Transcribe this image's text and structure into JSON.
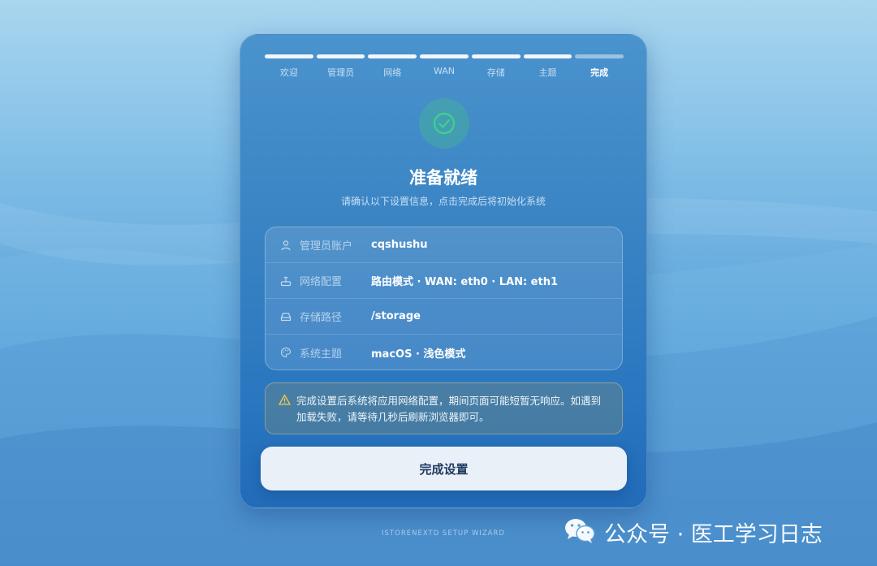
{
  "steps": [
    {
      "label": "欢迎"
    },
    {
      "label": "管理员"
    },
    {
      "label": "网络"
    },
    {
      "label": "WAN"
    },
    {
      "label": "存储"
    },
    {
      "label": "主题"
    },
    {
      "label": "完成"
    }
  ],
  "current_step": "完成",
  "header": {
    "title": "准备就绪",
    "subtitle": "请确认以下设置信息，点击完成后将初始化系统"
  },
  "summary": [
    {
      "icon": "user-icon",
      "label": "管理员账户",
      "value": "cqshushu"
    },
    {
      "icon": "router-icon",
      "label": "网络配置",
      "value": "路由模式 · WAN: eth0 · LAN: eth1"
    },
    {
      "icon": "drive-icon",
      "label": "存储路径",
      "value": "/storage"
    },
    {
      "icon": "palette-icon",
      "label": "系统主题",
      "value": "macOS · 浅色模式"
    }
  ],
  "warning": {
    "icon": "warning-icon",
    "text": "完成设置后系统将应用网络配置，期间页面可能短暂无响应。如遇到加载失败，请等待几秒后刷新浏览器即可。"
  },
  "finish_button": {
    "label": "完成设置"
  },
  "footer": {
    "text": "ISTORENEXTD SETUP WIZARD"
  },
  "watermark": {
    "text": "公众号 · 医工学习日志",
    "icon": "wechat-icon"
  },
  "colors": {
    "success": "#3ecf8e",
    "warning": "#f2c94c",
    "button_bg": "#e9f0f8",
    "button_text": "#1f3a5f"
  }
}
